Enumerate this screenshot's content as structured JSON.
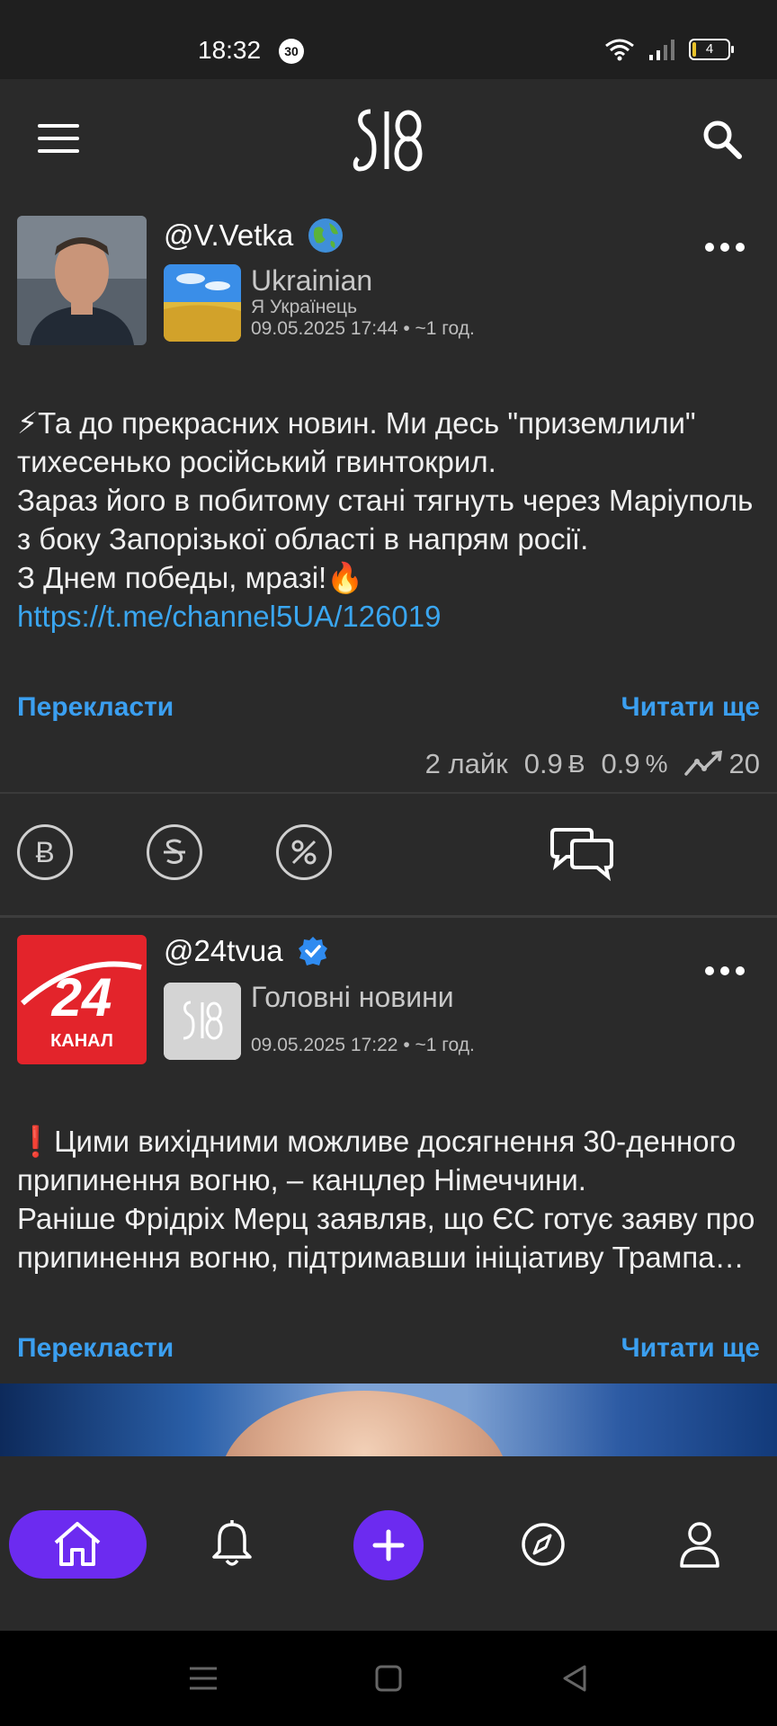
{
  "status_bar": {
    "time": "18:32",
    "notification_badge": "30",
    "battery_level": "4"
  },
  "header": {
    "logo_text": "S18"
  },
  "posts": [
    {
      "handle": "@V.Vetka",
      "group_name": "Ukrainian",
      "group_subtitle": "Я Українець",
      "timestamp": "09.05.2025 17:44 • ~1 год.",
      "text": "⚡Та до прекрасних новин. Ми десь \"приземлили\" тихесенько російський гвинтокрил.\nЗараз його в побитому стані тягнуть через Маріуполь з боку Запорізької області в напрям росії.\nЗ Днем победы, мразі!🔥",
      "link": "https://t.me/channel5UA/126019",
      "translate_label": "Перекласти",
      "read_more_label": "Читати ще",
      "likes": "2 лайк",
      "coin_value": "0.9",
      "percent_value": "0.9",
      "trend_value": "20"
    },
    {
      "handle": "@24tvua",
      "avatar_label_big": "24",
      "avatar_label_small": "КАНАЛ",
      "group_name": "Головні новини",
      "timestamp": "09.05.2025 17:22 • ~1 год.",
      "text": "❗Цими вихідними можливе досягнення 30-денного припинення вогню, – канцлер Німеччини.\nРаніше Фрідріх Мерц заявляв, що ЄС готує заяву про припинення вогню, підтримавши ініціативу Трампа…",
      "translate_label": "Перекласти",
      "read_more_label": "Читати ще"
    }
  ],
  "icons": {
    "menu": "hamburger-icon",
    "search": "search-icon",
    "more": "more-dots-icon",
    "globe": "globe-icon",
    "verified": "verified-badge-icon",
    "coin": "coin-icon",
    "dollar": "strike-coin-icon",
    "percent": "percent-icon",
    "comments": "comments-icon",
    "home": "home-icon",
    "bell": "bell-icon",
    "add": "plus-icon",
    "explore": "compass-icon",
    "profile": "user-icon"
  },
  "colors": {
    "accent": "#6c2bf0",
    "link": "#3b9ff0",
    "background": "#2a2a2a"
  }
}
